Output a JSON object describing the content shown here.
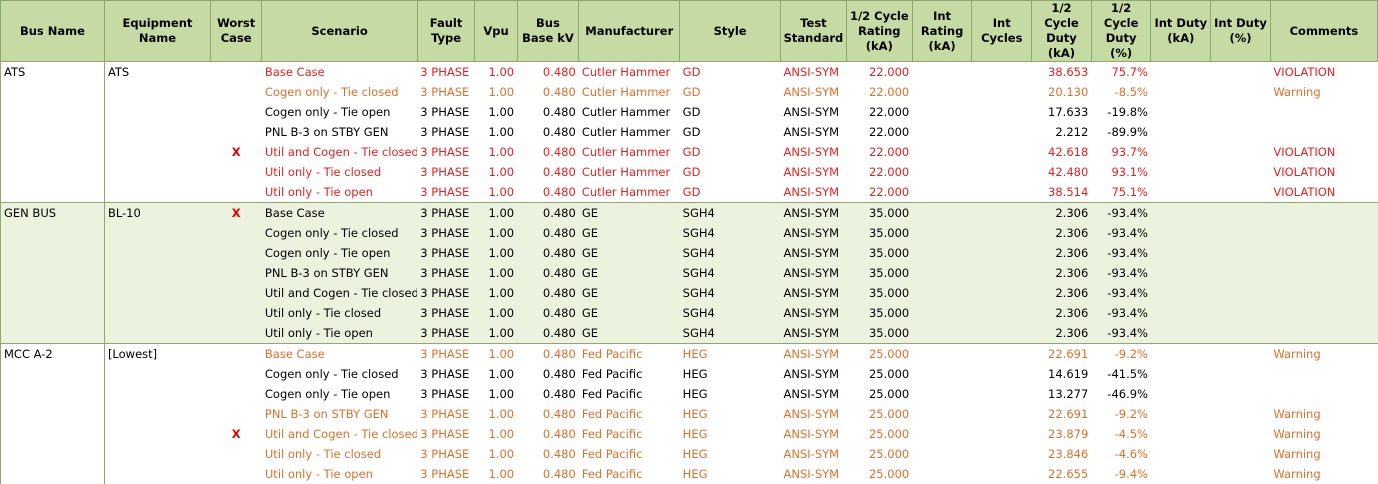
{
  "colors": {
    "header_bg": "#c5dba3",
    "shade_bg": "#ebf2de",
    "violation": "#e52020",
    "warning": "#d9702b",
    "worst_mark": "#e00000"
  },
  "headers": [
    "Bus Name",
    "Equipment Name",
    "Worst Case",
    "Scenario",
    "Fault Type",
    "Vpu",
    "Bus Base kV",
    "Manufacturer",
    "Style",
    "Test Standard",
    "1/2 Cycle Rating (kA)",
    "Int Rating (kA)",
    "Int Cycles",
    "1/2 Cycle Duty (kA)",
    "1/2 Cycle Duty (%)",
    "Int Duty (kA)",
    "Int Duty (%)",
    "Comments"
  ],
  "groups": [
    {
      "bus": "ATS",
      "equipment": "ATS",
      "rows": [
        {
          "status": "red",
          "worst": "",
          "scenario": "Base Case",
          "fault": "3 PHASE",
          "vpu": "1.00",
          "kv": "0.480",
          "mfr": "Cutler Hammer",
          "style": "GD",
          "std": "ANSI-SYM",
          "rating": "22.000",
          "int_rating": "",
          "int_cycles": "",
          "duty_ka": "38.653",
          "duty_pct": "75.7%",
          "int_duty_ka": "",
          "int_duty_pct": "",
          "comment": "VIOLATION"
        },
        {
          "status": "orange",
          "worst": "",
          "scenario": "Cogen only - Tie closed",
          "fault": "3 PHASE",
          "vpu": "1.00",
          "kv": "0.480",
          "mfr": "Cutler Hammer",
          "style": "GD",
          "std": "ANSI-SYM",
          "rating": "22.000",
          "int_rating": "",
          "int_cycles": "",
          "duty_ka": "20.130",
          "duty_pct": "-8.5%",
          "int_duty_ka": "",
          "int_duty_pct": "",
          "comment": "Warning"
        },
        {
          "status": "black",
          "worst": "",
          "scenario": "Cogen only - Tie open",
          "fault": "3 PHASE",
          "vpu": "1.00",
          "kv": "0.480",
          "mfr": "Cutler Hammer",
          "style": "GD",
          "std": "ANSI-SYM",
          "rating": "22.000",
          "int_rating": "",
          "int_cycles": "",
          "duty_ka": "17.633",
          "duty_pct": "-19.8%",
          "int_duty_ka": "",
          "int_duty_pct": "",
          "comment": ""
        },
        {
          "status": "black",
          "worst": "",
          "scenario": "PNL B-3 on STBY GEN",
          "fault": "3 PHASE",
          "vpu": "1.00",
          "kv": "0.480",
          "mfr": "Cutler Hammer",
          "style": "GD",
          "std": "ANSI-SYM",
          "rating": "22.000",
          "int_rating": "",
          "int_cycles": "",
          "duty_ka": "2.212",
          "duty_pct": "-89.9%",
          "int_duty_ka": "",
          "int_duty_pct": "",
          "comment": ""
        },
        {
          "status": "red",
          "worst": "X",
          "scenario": "Util and Cogen - Tie closed",
          "fault": "3 PHASE",
          "vpu": "1.00",
          "kv": "0.480",
          "mfr": "Cutler Hammer",
          "style": "GD",
          "std": "ANSI-SYM",
          "rating": "22.000",
          "int_rating": "",
          "int_cycles": "",
          "duty_ka": "42.618",
          "duty_pct": "93.7%",
          "int_duty_ka": "",
          "int_duty_pct": "",
          "comment": "VIOLATION"
        },
        {
          "status": "red",
          "worst": "",
          "scenario": "Util only - Tie closed",
          "fault": "3 PHASE",
          "vpu": "1.00",
          "kv": "0.480",
          "mfr": "Cutler Hammer",
          "style": "GD",
          "std": "ANSI-SYM",
          "rating": "22.000",
          "int_rating": "",
          "int_cycles": "",
          "duty_ka": "42.480",
          "duty_pct": "93.1%",
          "int_duty_ka": "",
          "int_duty_pct": "",
          "comment": "VIOLATION"
        },
        {
          "status": "red",
          "worst": "",
          "scenario": "Util only - Tie open",
          "fault": "3 PHASE",
          "vpu": "1.00",
          "kv": "0.480",
          "mfr": "Cutler Hammer",
          "style": "GD",
          "std": "ANSI-SYM",
          "rating": "22.000",
          "int_rating": "",
          "int_cycles": "",
          "duty_ka": "38.514",
          "duty_pct": "75.1%",
          "int_duty_ka": "",
          "int_duty_pct": "",
          "comment": "VIOLATION"
        }
      ]
    },
    {
      "bus": "GEN BUS",
      "equipment": "BL-10",
      "rows": [
        {
          "status": "black",
          "worst": "X",
          "scenario": "Base Case",
          "fault": "3 PHASE",
          "vpu": "1.00",
          "kv": "0.480",
          "mfr": "GE",
          "style": "SGH4",
          "std": "ANSI-SYM",
          "rating": "35.000",
          "int_rating": "",
          "int_cycles": "",
          "duty_ka": "2.306",
          "duty_pct": "-93.4%",
          "int_duty_ka": "",
          "int_duty_pct": "",
          "comment": ""
        },
        {
          "status": "black",
          "worst": "",
          "scenario": "Cogen only - Tie closed",
          "fault": "3 PHASE",
          "vpu": "1.00",
          "kv": "0.480",
          "mfr": "GE",
          "style": "SGH4",
          "std": "ANSI-SYM",
          "rating": "35.000",
          "int_rating": "",
          "int_cycles": "",
          "duty_ka": "2.306",
          "duty_pct": "-93.4%",
          "int_duty_ka": "",
          "int_duty_pct": "",
          "comment": ""
        },
        {
          "status": "black",
          "worst": "",
          "scenario": "Cogen only - Tie open",
          "fault": "3 PHASE",
          "vpu": "1.00",
          "kv": "0.480",
          "mfr": "GE",
          "style": "SGH4",
          "std": "ANSI-SYM",
          "rating": "35.000",
          "int_rating": "",
          "int_cycles": "",
          "duty_ka": "2.306",
          "duty_pct": "-93.4%",
          "int_duty_ka": "",
          "int_duty_pct": "",
          "comment": ""
        },
        {
          "status": "black",
          "worst": "",
          "scenario": "PNL B-3 on STBY GEN",
          "fault": "3 PHASE",
          "vpu": "1.00",
          "kv": "0.480",
          "mfr": "GE",
          "style": "SGH4",
          "std": "ANSI-SYM",
          "rating": "35.000",
          "int_rating": "",
          "int_cycles": "",
          "duty_ka": "2.306",
          "duty_pct": "-93.4%",
          "int_duty_ka": "",
          "int_duty_pct": "",
          "comment": ""
        },
        {
          "status": "black",
          "worst": "",
          "scenario": "Util and Cogen - Tie closed",
          "fault": "3 PHASE",
          "vpu": "1.00",
          "kv": "0.480",
          "mfr": "GE",
          "style": "SGH4",
          "std": "ANSI-SYM",
          "rating": "35.000",
          "int_rating": "",
          "int_cycles": "",
          "duty_ka": "2.306",
          "duty_pct": "-93.4%",
          "int_duty_ka": "",
          "int_duty_pct": "",
          "comment": ""
        },
        {
          "status": "black",
          "worst": "",
          "scenario": "Util only - Tie closed",
          "fault": "3 PHASE",
          "vpu": "1.00",
          "kv": "0.480",
          "mfr": "GE",
          "style": "SGH4",
          "std": "ANSI-SYM",
          "rating": "35.000",
          "int_rating": "",
          "int_cycles": "",
          "duty_ka": "2.306",
          "duty_pct": "-93.4%",
          "int_duty_ka": "",
          "int_duty_pct": "",
          "comment": ""
        },
        {
          "status": "black",
          "worst": "",
          "scenario": "Util only - Tie open",
          "fault": "3 PHASE",
          "vpu": "1.00",
          "kv": "0.480",
          "mfr": "GE",
          "style": "SGH4",
          "std": "ANSI-SYM",
          "rating": "35.000",
          "int_rating": "",
          "int_cycles": "",
          "duty_ka": "2.306",
          "duty_pct": "-93.4%",
          "int_duty_ka": "",
          "int_duty_pct": "",
          "comment": ""
        }
      ]
    },
    {
      "bus": "MCC A-2",
      "equipment": "[Lowest]",
      "rows": [
        {
          "status": "orange",
          "worst": "",
          "scenario": "Base Case",
          "fault": "3 PHASE",
          "vpu": "1.00",
          "kv": "0.480",
          "mfr": "Fed Pacific",
          "style": "HEG",
          "std": "ANSI-SYM",
          "rating": "25.000",
          "int_rating": "",
          "int_cycles": "",
          "duty_ka": "22.691",
          "duty_pct": "-9.2%",
          "int_duty_ka": "",
          "int_duty_pct": "",
          "comment": "Warning"
        },
        {
          "status": "black",
          "worst": "",
          "scenario": "Cogen only - Tie closed",
          "fault": "3 PHASE",
          "vpu": "1.00",
          "kv": "0.480",
          "mfr": "Fed Pacific",
          "style": "HEG",
          "std": "ANSI-SYM",
          "rating": "25.000",
          "int_rating": "",
          "int_cycles": "",
          "duty_ka": "14.619",
          "duty_pct": "-41.5%",
          "int_duty_ka": "",
          "int_duty_pct": "",
          "comment": ""
        },
        {
          "status": "black",
          "worst": "",
          "scenario": "Cogen only - Tie open",
          "fault": "3 PHASE",
          "vpu": "1.00",
          "kv": "0.480",
          "mfr": "Fed Pacific",
          "style": "HEG",
          "std": "ANSI-SYM",
          "rating": "25.000",
          "int_rating": "",
          "int_cycles": "",
          "duty_ka": "13.277",
          "duty_pct": "-46.9%",
          "int_duty_ka": "",
          "int_duty_pct": "",
          "comment": ""
        },
        {
          "status": "orange",
          "worst": "",
          "scenario": "PNL B-3 on STBY GEN",
          "fault": "3 PHASE",
          "vpu": "1.00",
          "kv": "0.480",
          "mfr": "Fed Pacific",
          "style": "HEG",
          "std": "ANSI-SYM",
          "rating": "25.000",
          "int_rating": "",
          "int_cycles": "",
          "duty_ka": "22.691",
          "duty_pct": "-9.2%",
          "int_duty_ka": "",
          "int_duty_pct": "",
          "comment": "Warning"
        },
        {
          "status": "orange",
          "worst": "X",
          "scenario": "Util and Cogen - Tie closed",
          "fault": "3 PHASE",
          "vpu": "1.00",
          "kv": "0.480",
          "mfr": "Fed Pacific",
          "style": "HEG",
          "std": "ANSI-SYM",
          "rating": "25.000",
          "int_rating": "",
          "int_cycles": "",
          "duty_ka": "23.879",
          "duty_pct": "-4.5%",
          "int_duty_ka": "",
          "int_duty_pct": "",
          "comment": "Warning"
        },
        {
          "status": "orange",
          "worst": "",
          "scenario": "Util only - Tie closed",
          "fault": "3 PHASE",
          "vpu": "1.00",
          "kv": "0.480",
          "mfr": "Fed Pacific",
          "style": "HEG",
          "std": "ANSI-SYM",
          "rating": "25.000",
          "int_rating": "",
          "int_cycles": "",
          "duty_ka": "23.846",
          "duty_pct": "-4.6%",
          "int_duty_ka": "",
          "int_duty_pct": "",
          "comment": "Warning"
        },
        {
          "status": "orange",
          "worst": "",
          "scenario": "Util only - Tie open",
          "fault": "3 PHASE",
          "vpu": "1.00",
          "kv": "0.480",
          "mfr": "Fed Pacific",
          "style": "HEG",
          "std": "ANSI-SYM",
          "rating": "25.000",
          "int_rating": "",
          "int_cycles": "",
          "duty_ka": "22.655",
          "duty_pct": "-9.4%",
          "int_duty_ka": "",
          "int_duty_pct": "",
          "comment": "Warning"
        }
      ]
    }
  ]
}
